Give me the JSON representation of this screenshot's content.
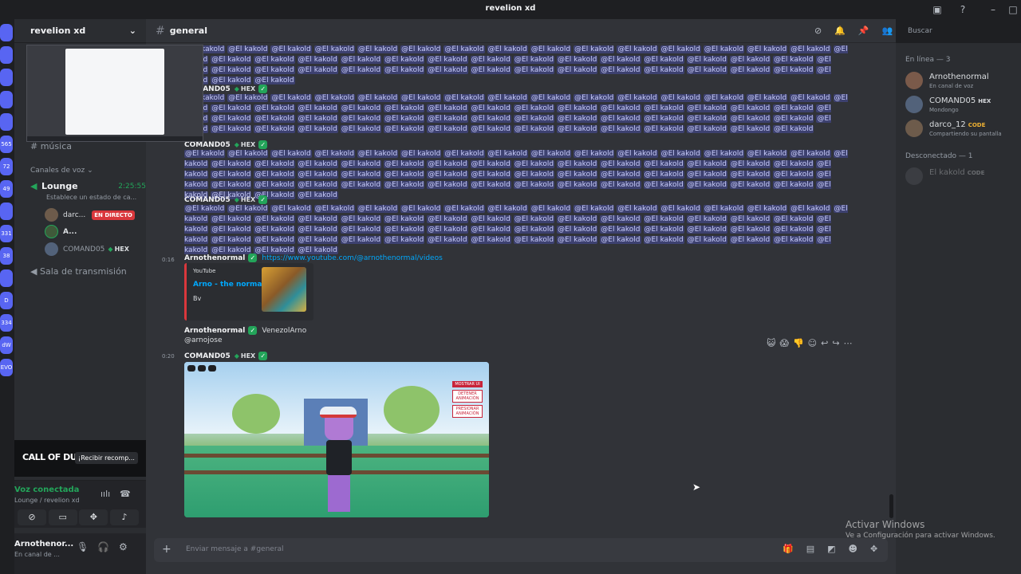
{
  "window": {
    "title": "revelion xd"
  },
  "servers": [
    "",
    "",
    "",
    "",
    "",
    "565",
    "72",
    "49",
    "",
    "331",
    "38",
    "",
    "D",
    "334",
    "dW",
    "EVO"
  ],
  "sidebar": {
    "guild_name": "revelion xd",
    "channel_musica": "música",
    "voice_category": "Canales de voz",
    "lounge": {
      "name": "Lounge",
      "time": "2:25:55",
      "status": "Establece un estado de ca..."
    },
    "voice_users": [
      {
        "name": "darc...",
        "live": "EN DIRECTO"
      },
      {
        "name": "A..."
      },
      {
        "name": "COMAND05",
        "badge": "HEX"
      }
    ],
    "stream_room": "Sala de transmisión",
    "promo": {
      "brand": "CALL OF DUTY",
      "claim": "¡Recibir recomp..."
    },
    "voice": {
      "state": "Voz conectada",
      "location": "Lounge / revelion xd"
    },
    "user": {
      "name": "Arnothenor...",
      "status": "En canal de ..."
    }
  },
  "chat": {
    "channel": "general",
    "search_placeholder": "Buscar",
    "mention": "@El kakold",
    "messages": [
      {
        "author": "COMAND05",
        "badge": "HEX"
      },
      {
        "author": "COMAND05",
        "badge": "HEX"
      },
      {
        "author": "COMAND05",
        "badge": "HEX"
      },
      {
        "time": "0:16",
        "author": "Arnothenormal",
        "link": "https://www.youtube.com/@arnothenormal/videos"
      },
      {
        "author": "Arnothenormal",
        "text": "VenezolArno",
        "subtext": "@arnojose"
      },
      {
        "time": "0:20",
        "author": "COMAND05",
        "badge": "HEX"
      }
    ],
    "embed": {
      "provider": "YouTube",
      "title": "Arno - the normal",
      "desc": "Bv"
    },
    "video_panel": [
      "MOSTRAR UI",
      "DETENER ANIMACIÓN",
      "PRESIONAR ANIMACIÓN"
    ],
    "composer_placeholder": "Enviar mensaje a #general"
  },
  "members": {
    "online_header": "En línea — 3",
    "online": [
      {
        "name": "Arnothenormal",
        "sub": "En canal de voz"
      },
      {
        "name": "COMAND05",
        "badge": "HEX",
        "sub": "Mondongo"
      },
      {
        "name": "darco_12",
        "badge": "CODE",
        "sub": "Compartiendo su pantalla"
      }
    ],
    "offline_header": "Desconectado — 1",
    "offline": [
      {
        "name": "El kakold",
        "badge": "CODE"
      }
    ]
  },
  "watermark": {
    "title": "Activar Windows",
    "sub": "Ve a Configuración para activar Windows."
  }
}
